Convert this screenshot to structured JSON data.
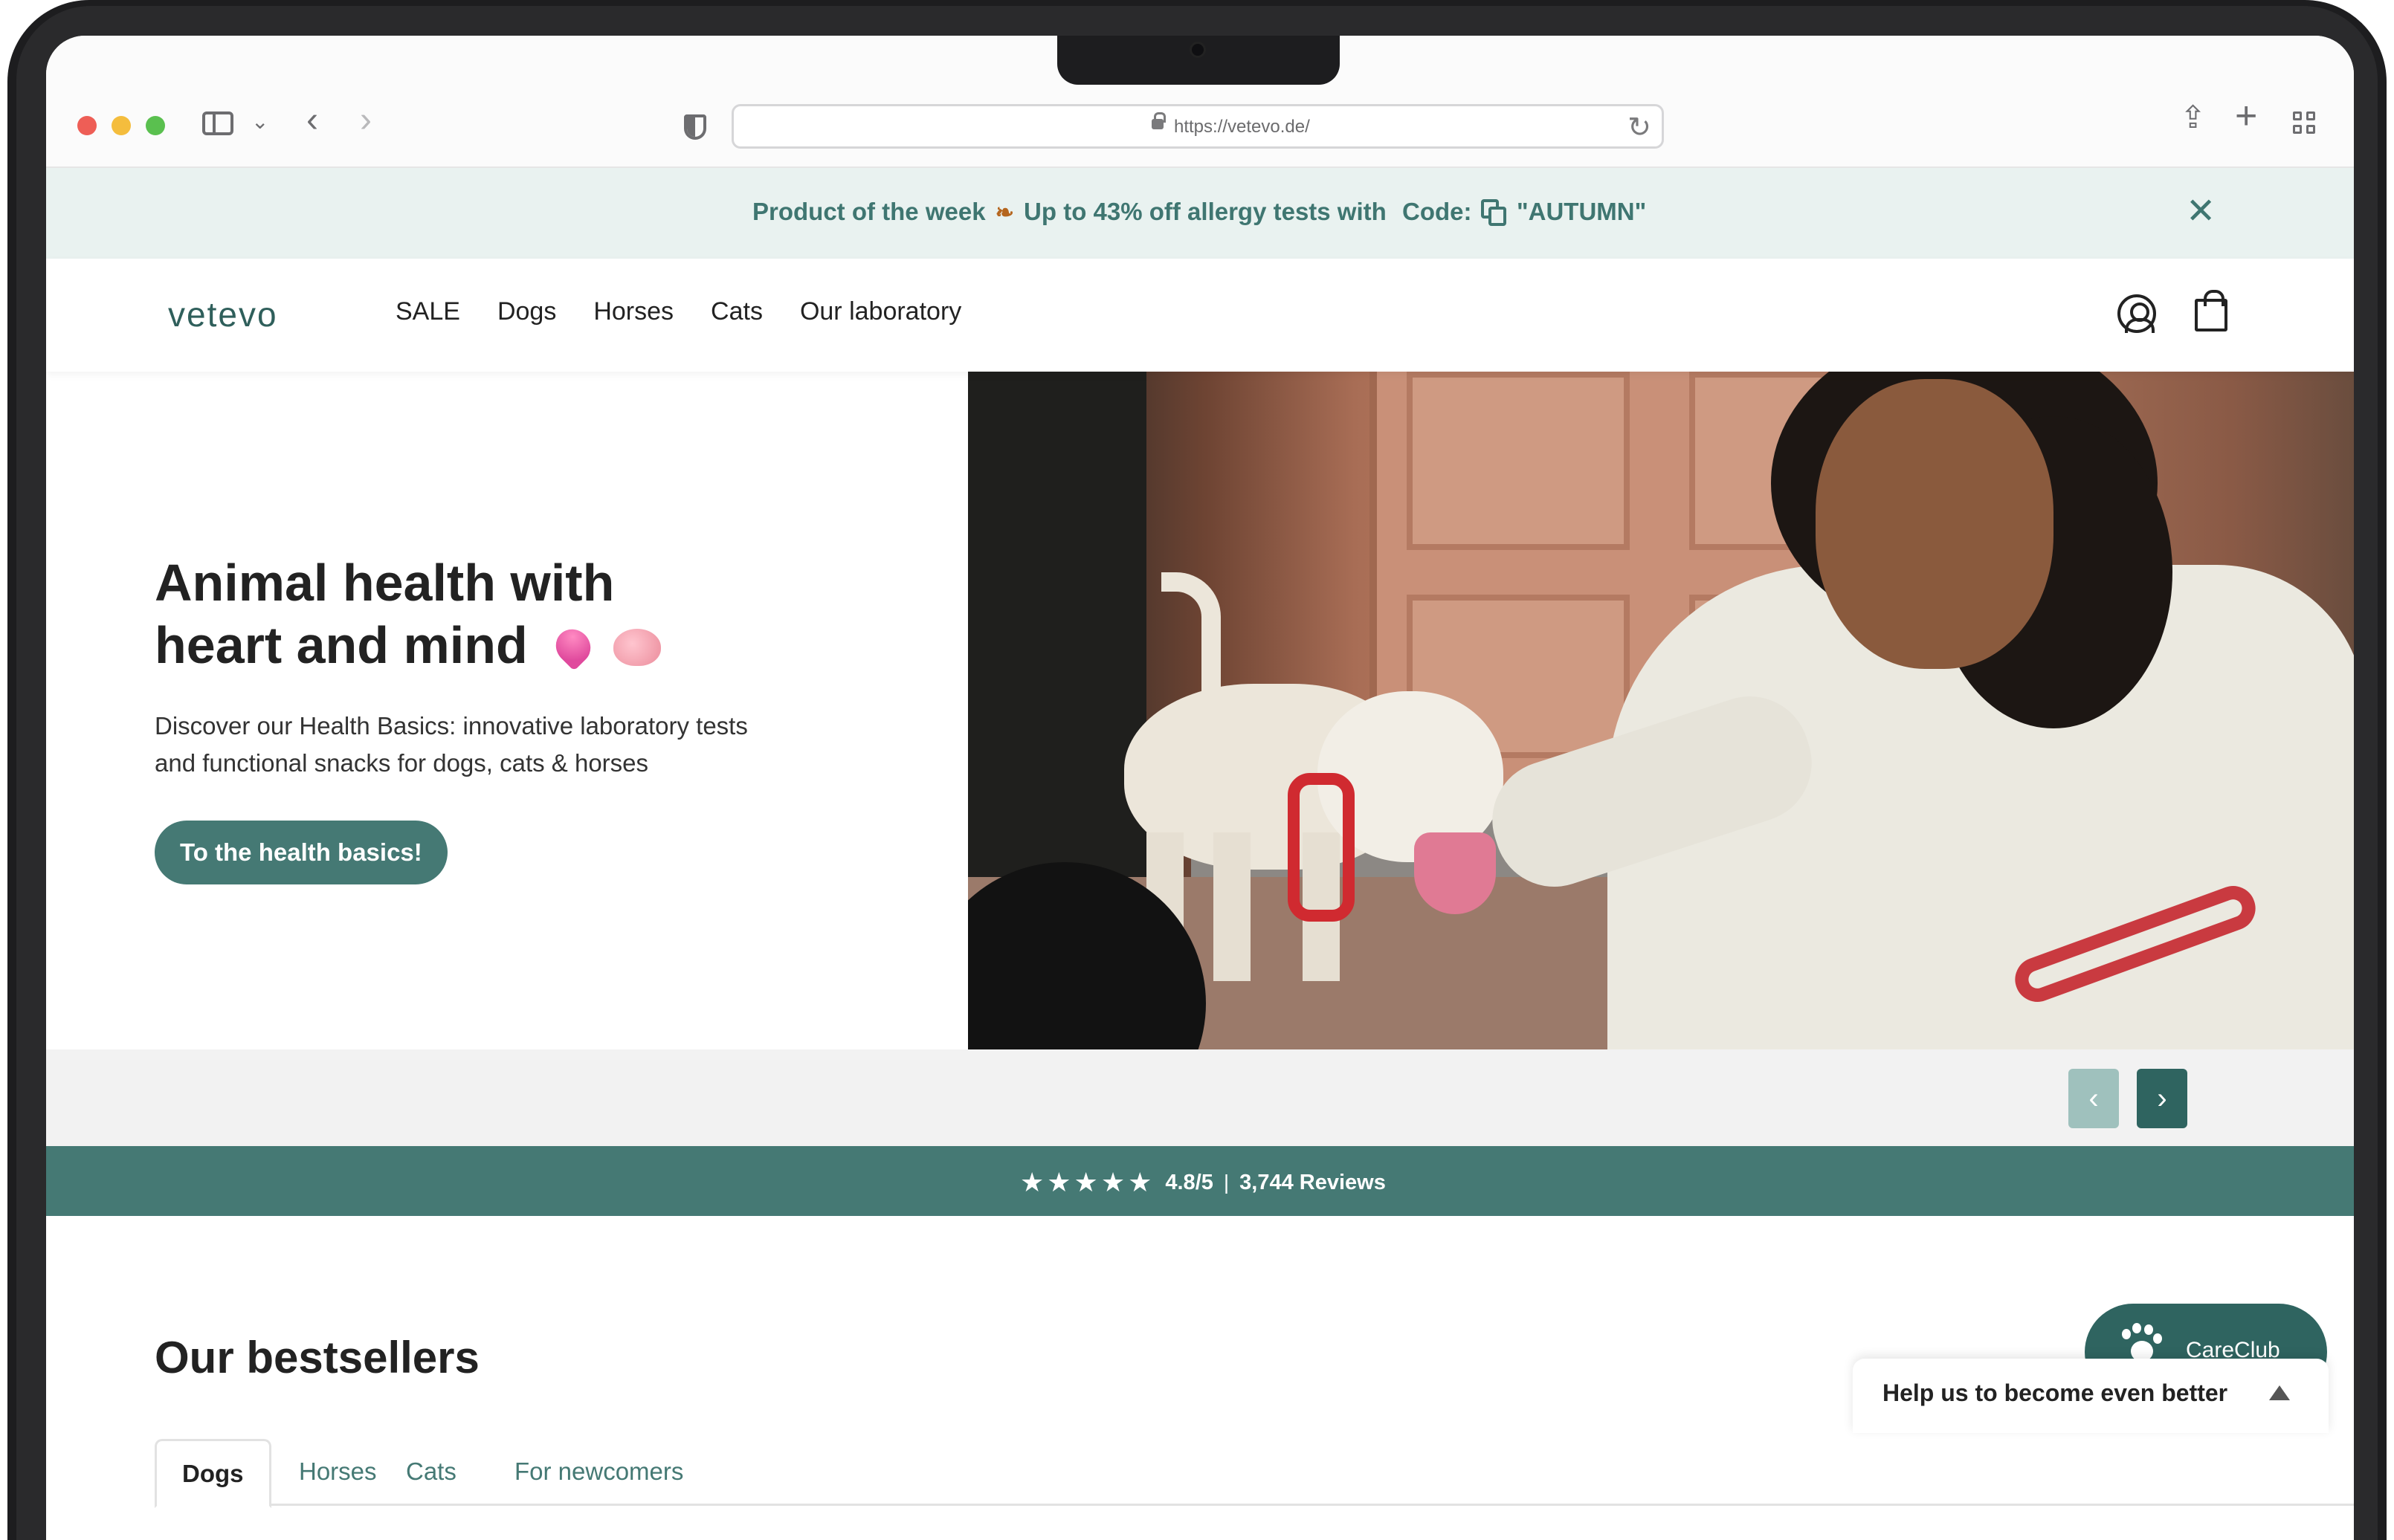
{
  "browser": {
    "url": "https://vetevo.de/"
  },
  "promo": {
    "text_part1": "Product of the week",
    "text_part2": "Up to 43% off allergy tests with",
    "code_label": "Code:",
    "code": "\"AUTUMN\""
  },
  "header": {
    "logo": "vetevo",
    "nav": [
      "SALE",
      "Dogs",
      "Horses",
      "Cats",
      "Our laboratory"
    ]
  },
  "hero": {
    "title": "Animal health with heart and mind",
    "subtitle": "Discover our Health Basics: innovative laboratory tests and functional snacks for dogs, cats & horses",
    "cta": "To the health basics!",
    "prev_arrow": "‹",
    "next_arrow": "›"
  },
  "reviews": {
    "stars_glyph": "★★★★★",
    "rating": "4.8/5",
    "separator": "|",
    "count": "3,744 Reviews"
  },
  "bestsellers": {
    "title": "Our bestsellers",
    "tabs": [
      "Dogs",
      "Horses",
      "Cats",
      "For newcomers"
    ],
    "active_tab": "Dogs"
  },
  "widgets": {
    "careclub_label": "CareClub",
    "feedback_label": "Help us to become even better"
  },
  "colors": {
    "brand": "#457974",
    "brand_dark": "#2f6460",
    "promo_bg": "#e9f2f0"
  }
}
